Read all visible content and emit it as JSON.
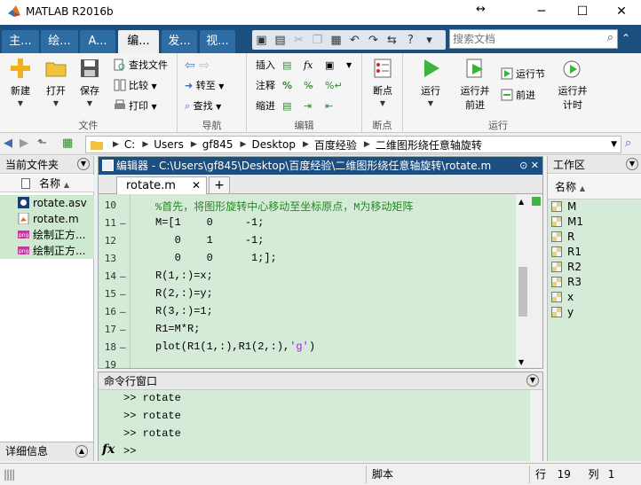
{
  "window": {
    "title": "MATLAB R2016b",
    "minimize": "─",
    "maximize": "☐",
    "close": "✕",
    "dock_arrows": "↔"
  },
  "tabs": [
    {
      "label": "主..."
    },
    {
      "label": "绘..."
    },
    {
      "label": "A..."
    },
    {
      "label": "编..."
    },
    {
      "label": "发..."
    },
    {
      "label": "视..."
    }
  ],
  "search": {
    "placeholder": "搜索文档"
  },
  "ribbon": {
    "file": {
      "label": "文件",
      "new": "新建",
      "open": "打开",
      "save": "保存",
      "find_files": "查找文件",
      "compare": "比较",
      "print": "打印"
    },
    "nav": {
      "label": "导航",
      "goto": "转至",
      "find": "查找"
    },
    "edit": {
      "label": "编辑",
      "insert": "插入",
      "comment": "注释",
      "indent": "缩进"
    },
    "breakpoints": {
      "label": "断点",
      "button": "断点"
    },
    "run": {
      "label": "运行",
      "run": "运行",
      "run_advance_1": "运行并",
      "run_advance_2": "前进",
      "run_section": "运行节",
      "advance": "前进",
      "run_time_1": "运行并",
      "run_time_2": "计时"
    }
  },
  "address": {
    "crumbs": [
      "C:",
      "Users",
      "gf845",
      "Desktop",
      "百度经验",
      "二维图形绕任意轴旋转"
    ]
  },
  "current_folder": {
    "title": "当前文件夹",
    "column": "名称",
    "sort": "▲",
    "files": [
      {
        "name": "rotate.asv"
      },
      {
        "name": "rotate.m"
      },
      {
        "name": "绘制正方..."
      },
      {
        "name": "绘制正方..."
      }
    ]
  },
  "editor": {
    "title": "编辑器 - C:\\Users\\gf845\\Desktop\\百度经验\\二维图形绕任意轴旋转\\rotate.m",
    "tab": "rotate.m",
    "lines": [
      {
        "n": "10",
        "dash": "",
        "code": "%首先，将图形旋转中心移动至坐标原点，M为移动矩阵"
      },
      {
        "n": "11",
        "dash": "–",
        "code": "M=[1    0     -1;"
      },
      {
        "n": "12",
        "dash": "",
        "code": "   0    1     -1;"
      },
      {
        "n": "13",
        "dash": "",
        "code": "   0    0      1;];"
      },
      {
        "n": "14",
        "dash": "–",
        "code": "R(1,:)=x;"
      },
      {
        "n": "15",
        "dash": "–",
        "code": "R(2,:)=y;"
      },
      {
        "n": "16",
        "dash": "–",
        "code": "R(3,:)=1;"
      },
      {
        "n": "17",
        "dash": "–",
        "code": "R1=M*R;"
      },
      {
        "n": "18",
        "dash": "–",
        "code_pre": "plot(R1(1,:),R1(2,:),",
        "code_str": "'g'",
        "code_post": ")"
      },
      {
        "n": "19",
        "dash": "",
        "code": ""
      }
    ]
  },
  "command_window": {
    "title": "命令行窗口",
    "history": [
      ">> rotate",
      ">> rotate",
      ">> rotate"
    ],
    "prompt": ">>",
    "fx": "fx"
  },
  "details": {
    "title": "详细信息"
  },
  "workspace": {
    "title": "工作区",
    "column": "名称",
    "sort": "▲",
    "vars": [
      "M",
      "M1",
      "R",
      "R1",
      "R2",
      "R3",
      "x",
      "y"
    ]
  },
  "status": {
    "mode": "脚本",
    "row_label": "行",
    "row": "19",
    "col_label": "列",
    "col": "1"
  },
  "colors": {
    "accent_blue": "#1c4e80",
    "code_bg": "#d5ead7",
    "comment": "#228b22",
    "string": "#a020f0"
  }
}
